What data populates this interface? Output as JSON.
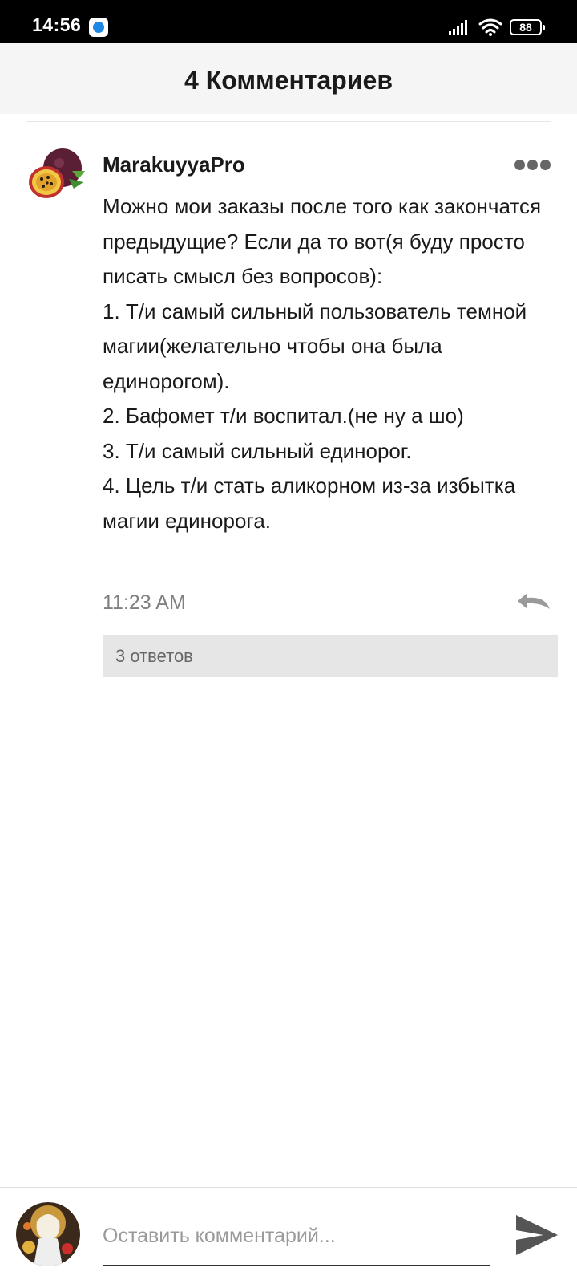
{
  "status_bar": {
    "time": "14:56",
    "battery_level": "88",
    "icons": [
      "app-notification-icon",
      "signal-icon",
      "wifi-icon",
      "battery-icon"
    ]
  },
  "header": {
    "title": "4 Комментариев"
  },
  "comment": {
    "author": "MarakuyyaPro",
    "avatar": "passion-fruit-avatar",
    "text": "Можно мои заказы после того как закончатся предыдущие? Если да то вот(я буду просто писать смысл без вопросов):\n1. Т/и самый сильный пользователь темной магии(желательно чтобы она была единорогом).\n2. Бафомет т/и воспитал.(не ну а шо)\n3. Т/и самый сильный единорог.\n4. Цель т/и стать аликорном из-за избытка магии единорога.",
    "time": "11:23 AM",
    "replies_label": "3 ответов"
  },
  "input": {
    "placeholder": "Оставить комментарий..."
  },
  "colors": {
    "status_bar_bg": "#000000",
    "header_bg": "#f5f5f5",
    "text_primary": "#1a1a1a",
    "text_secondary": "#808080",
    "replies_bg": "#e6e6e6",
    "send_icon": "#555555"
  }
}
